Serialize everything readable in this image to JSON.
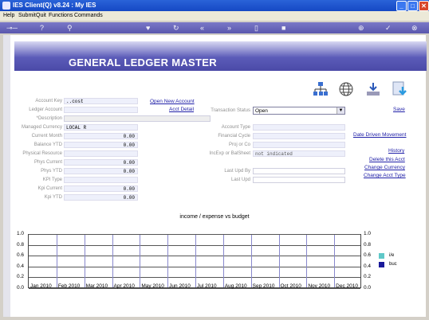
{
  "window": {
    "title": "IES Client(Q) v8.24 : My IES",
    "min": "_",
    "max": "□",
    "close": "✕"
  },
  "menu": [
    "Help",
    "Submit",
    "Quit",
    "Functions",
    "Commands"
  ],
  "header": {
    "title": "GENERAL LEDGER MASTER"
  },
  "left_fields": [
    {
      "label": "Account Key",
      "value": "..cost"
    },
    {
      "label": "Ledger Account",
      "value": ""
    },
    {
      "label": "*Description",
      "value": ""
    },
    {
      "label": "Managed Currency",
      "value": "LOCAL R"
    },
    {
      "label": "Current Month",
      "value": "0.00"
    },
    {
      "label": "Balance YTD",
      "value": "0.00"
    },
    {
      "label": "Physical Resource",
      "value": ""
    },
    {
      "label": "Phys Current",
      "value": "0.00"
    },
    {
      "label": "Phys YTD",
      "value": "0.00"
    },
    {
      "label": "KPI Type",
      "value": ""
    },
    {
      "label": "Kpi Current",
      "value": "0.00"
    },
    {
      "label": "Kpi YTD",
      "value": "0.00"
    }
  ],
  "mid_links": {
    "open_new": "Open New Account",
    "acct_detail": "Acct Detail"
  },
  "right_fields": {
    "transaction_status": {
      "label": "Transaction Status",
      "value": "Open"
    },
    "account_type": {
      "label": "Account Type",
      "value": ""
    },
    "financial_cycle": {
      "label": "Financial Cycle",
      "value": ""
    },
    "proj_or_co": {
      "label": "Proj or Co",
      "value": ""
    },
    "inc_exp": {
      "label": "IncExp or BalSheet",
      "value": "not indicated"
    },
    "last_upd_by": {
      "label": "Last Upd By",
      "value": ""
    },
    "last_upd": {
      "label": "Last Upd",
      "value": ""
    }
  },
  "right_links": {
    "save": "Save",
    "date_driven": "Date Driven Movement",
    "history": "History",
    "delete": "Delete this Acct",
    "change_currency": "Change Currency",
    "change_acct_type": "Change Acct Type"
  },
  "chart_data": {
    "type": "line",
    "title": "income / expense vs budget",
    "categories": [
      "Jan 2010",
      "Feb 2010",
      "Mar 2010",
      "Apr 2010",
      "May 2010",
      "Jun 2010",
      "Jul 2010",
      "Aug 2010",
      "Sep 2010",
      "Oct 2010",
      "Nov 2010",
      "Dec 2010"
    ],
    "ylim": [
      0,
      1.0
    ],
    "yticks": [
      "1.0",
      "0.8",
      "0.6",
      "0.4",
      "0.2",
      "0.0"
    ],
    "series": [
      {
        "name": "i/e",
        "color": "#5fc8c8",
        "values": []
      },
      {
        "name": "buc",
        "color": "#1a1a9a",
        "values": []
      }
    ]
  }
}
